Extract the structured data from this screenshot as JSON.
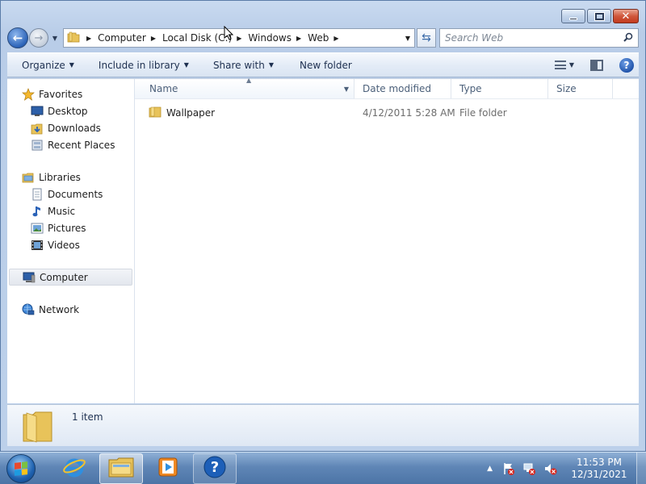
{
  "window": {
    "caption_buttons": [
      "minimize",
      "maximize",
      "close"
    ]
  },
  "address_bar": {
    "breadcrumbs": [
      "Computer",
      "Local Disk (C:)",
      "Windows",
      "Web"
    ]
  },
  "search": {
    "placeholder": "Search Web"
  },
  "toolbar": {
    "organize": "Organize",
    "include_in_library": "Include in library",
    "share_with": "Share with",
    "new_folder": "New folder"
  },
  "nav_pane": {
    "favorites": {
      "label": "Favorites",
      "items": [
        "Desktop",
        "Downloads",
        "Recent Places"
      ]
    },
    "libraries": {
      "label": "Libraries",
      "items": [
        "Documents",
        "Music",
        "Pictures",
        "Videos"
      ]
    },
    "computer": "Computer",
    "network": "Network"
  },
  "columns": [
    "Name",
    "Date modified",
    "Type",
    "Size"
  ],
  "files": [
    {
      "name": "Wallpaper",
      "date_modified": "4/12/2011 5:28 AM",
      "type": "File folder",
      "size": ""
    }
  ],
  "details": {
    "count": "1 item"
  },
  "taskbar": {
    "clock_time": "11:53 PM",
    "clock_date": "12/31/2021"
  },
  "colors": {
    "accent": "#2b63b8",
    "folder": "#e8c35a",
    "taskbar": "#5f86b6"
  }
}
